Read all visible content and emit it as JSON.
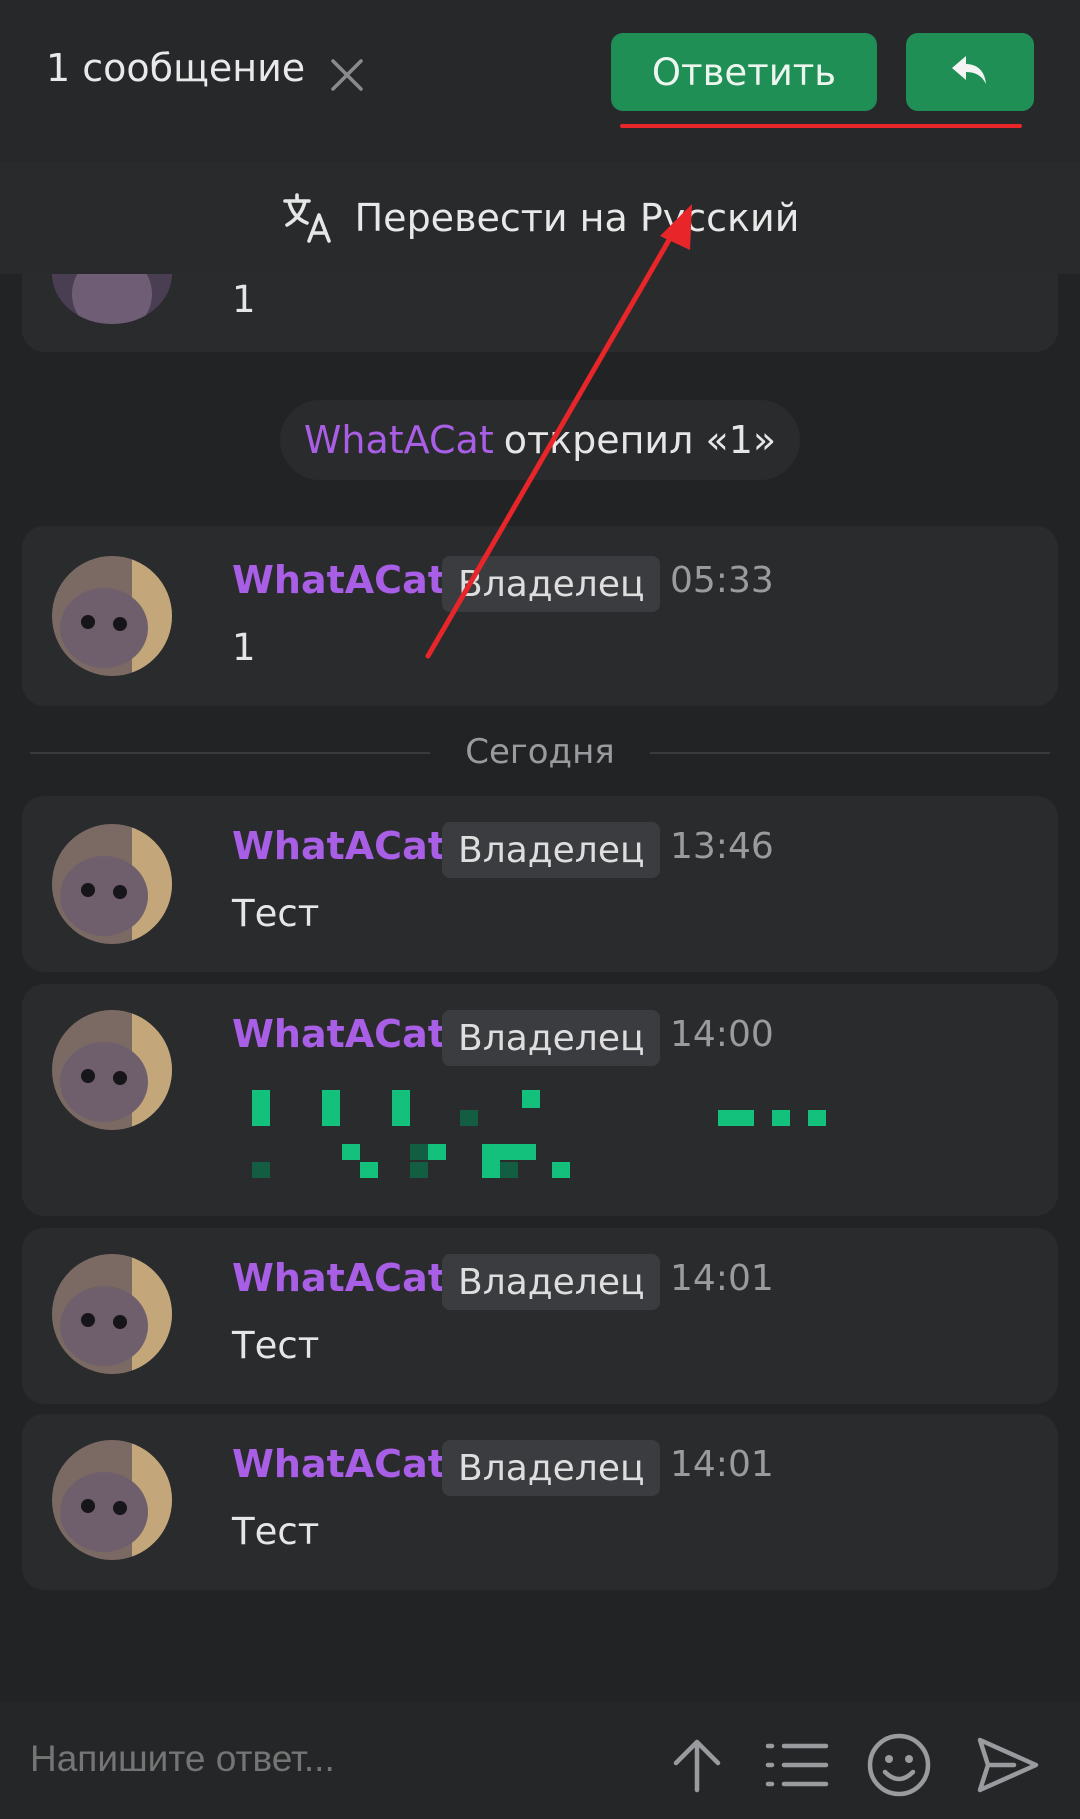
{
  "topbar": {
    "selection_count": "1 сообщение",
    "reply_label": "Ответить",
    "close_icon": "close-icon",
    "reply_icon": "reply-arrow-icon",
    "accent": "#1f8f56"
  },
  "translate": {
    "label": "Перевести на Русский",
    "icon": "translate-icon"
  },
  "partial_message": {
    "text": "1"
  },
  "system_event": {
    "actor": "WhatACat",
    "action": "открепил «1»"
  },
  "messages": [
    {
      "author": "WhatACat",
      "role": "Владелец",
      "time": "05:33",
      "text": "1"
    },
    {
      "author": "WhatACat",
      "role": "Владелец",
      "time": "13:46",
      "text": "Тест"
    },
    {
      "author": "WhatACat",
      "role": "Владелец",
      "time": "14:00",
      "text": ""
    },
    {
      "author": "WhatACat",
      "role": "Владелец",
      "time": "14:01",
      "text": "Тест"
    },
    {
      "author": "WhatACat",
      "role": "Владелец",
      "time": "14:01",
      "text": "Тест"
    }
  ],
  "date_separator": "Сегодня",
  "composer": {
    "placeholder": "Напишите ответ...",
    "icons": [
      "arrow-up-icon",
      "list-icon",
      "emoji-icon",
      "send-icon"
    ]
  },
  "colors": {
    "author": "#a95ee6",
    "annotation": "#e8262a"
  }
}
